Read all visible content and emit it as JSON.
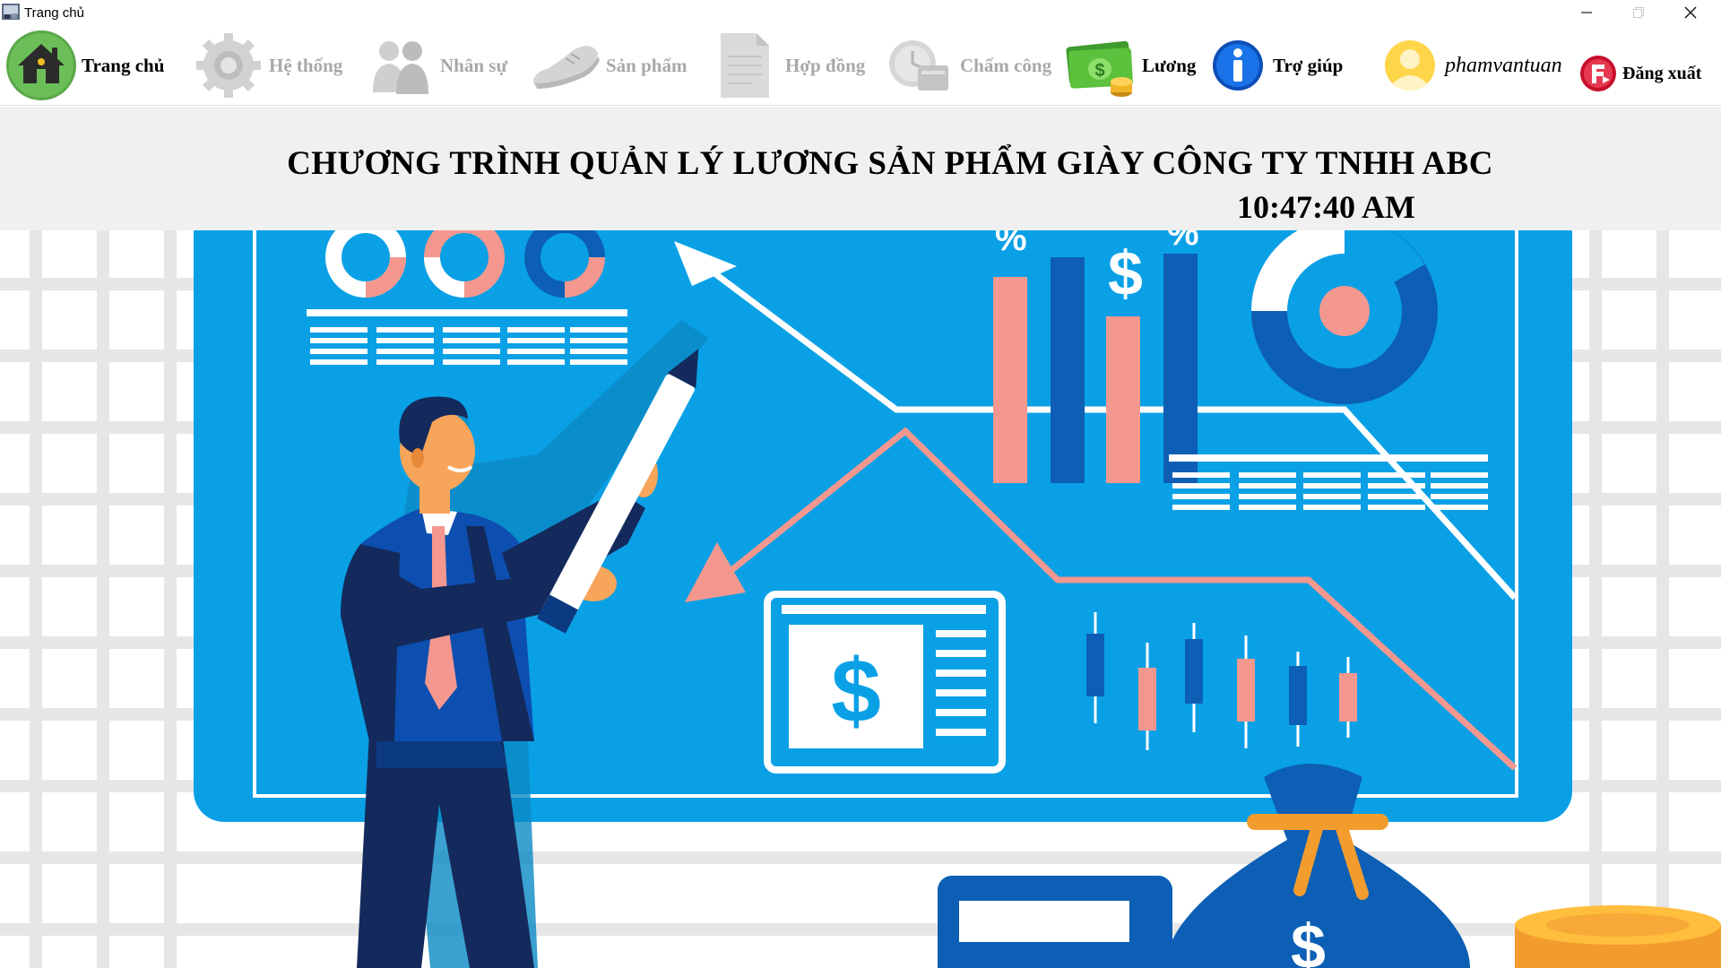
{
  "window": {
    "title": "Trang chủ",
    "controls": {
      "minimize": "—",
      "maximize": "▢",
      "close": "✕"
    }
  },
  "toolbar": {
    "items": [
      {
        "label": "Trang chủ",
        "icon": "home-icon",
        "enabled": true
      },
      {
        "label": "Hệ thống",
        "icon": "gear-icon",
        "enabled": false
      },
      {
        "label": "Nhân sự",
        "icon": "people-icon",
        "enabled": false
      },
      {
        "label": "Sản phẩm",
        "icon": "shoe-icon",
        "enabled": false
      },
      {
        "label": "Hợp đồng",
        "icon": "document-icon",
        "enabled": false
      },
      {
        "label": "Chấm công",
        "icon": "clock-card-icon",
        "enabled": false
      },
      {
        "label": "Lương",
        "icon": "money-icon",
        "enabled": true
      },
      {
        "label": "Trợ giúp",
        "icon": "info-icon",
        "enabled": true
      }
    ],
    "user": {
      "name": "phamvantuan",
      "icon": "user-avatar-icon"
    },
    "logout": {
      "label": "Đăng xuất",
      "icon": "logout-icon"
    }
  },
  "header": {
    "title": "CHƯƠNG TRÌNH QUẢN LÝ LƯƠNG SẢN PHẨM GIÀY CÔNG TY TNHH ABC",
    "clock": "10:47:40 AM"
  },
  "banner": {
    "board_symbols": [
      "%",
      "$",
      "%",
      "$"
    ],
    "colors": {
      "board": "#0aa0e6",
      "board_dark": "#0c5fb4",
      "pink": "#f4978e",
      "navy": "#142a5c",
      "grid": "#e6e6e6"
    }
  }
}
